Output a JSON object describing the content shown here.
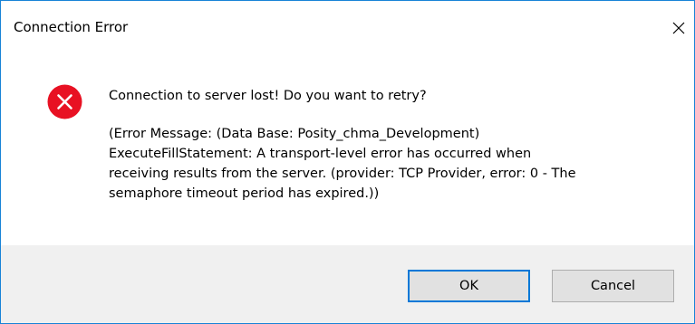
{
  "dialog": {
    "title": "Connection Error",
    "message": "Connection to server lost! Do you want to retry?",
    "detail": "(Error Message: (Data Base: Posity_chma_Development)\nExecuteFillStatement: A transport-level error has occurred when\nreceiving results from the server. (provider: TCP Provider, error: 0 - The\nsemaphore timeout period has expired.))",
    "icon": "error-icon",
    "buttons": {
      "ok_label": "OK",
      "cancel_label": "Cancel"
    }
  },
  "colors": {
    "error_red": "#e81123",
    "accent_blue": "#0078d7",
    "footer_bg": "#f0f0f0"
  }
}
